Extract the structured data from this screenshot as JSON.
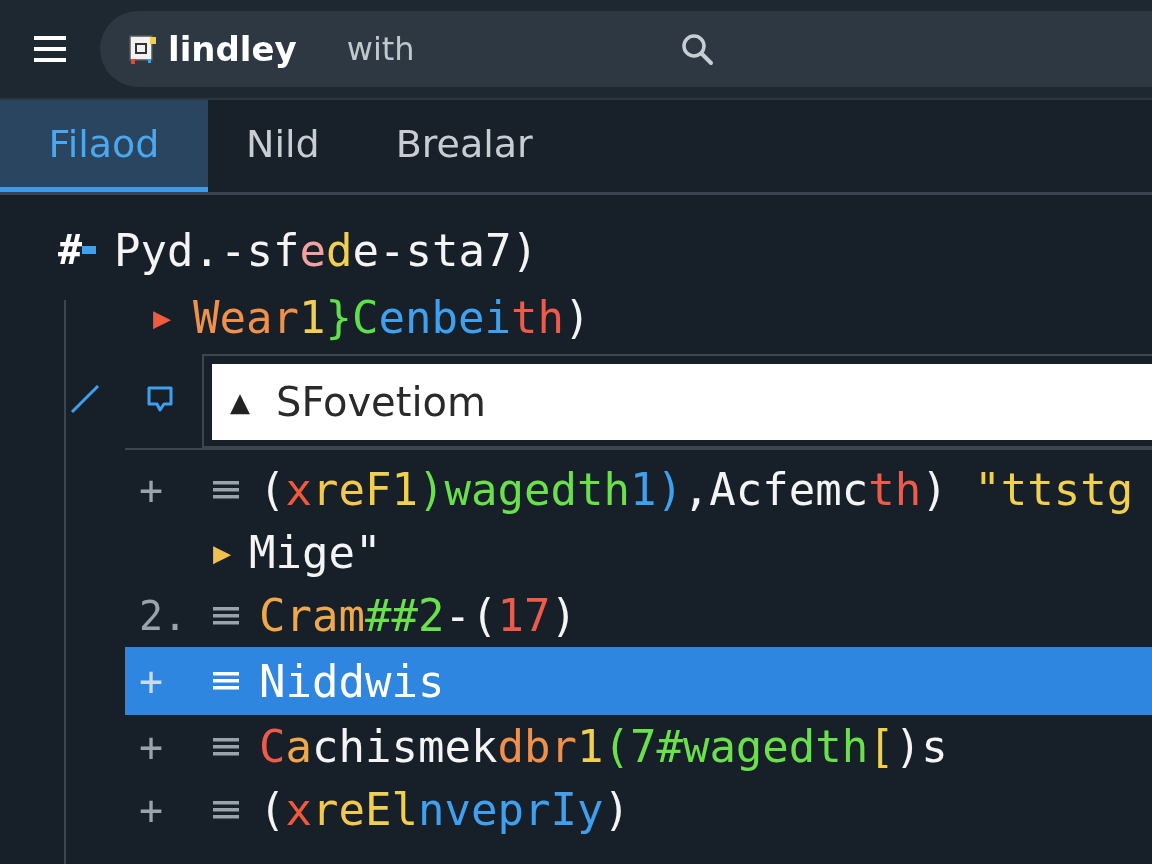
{
  "header": {
    "brand": "lindley",
    "search": {
      "value": "with"
    }
  },
  "tabs": [
    {
      "label": "Filaod",
      "selected": true
    },
    {
      "label": "Nild",
      "selected": false
    },
    {
      "label": "Brealar",
      "selected": false
    }
  ],
  "lines": [
    {
      "kind": "heading",
      "mark": "#",
      "segments": [
        {
          "text": "Pyd.-sf",
          "color": "#f4f4f4"
        },
        {
          "text": "e",
          "color": "#f2a0a0"
        },
        {
          "text": "d",
          "color": "#f2d04f"
        },
        {
          "text": "e-sta7)",
          "color": "#f4f4f4"
        }
      ]
    },
    {
      "kind": "branch",
      "marker": {
        "text": "▶",
        "color": "#f05a40"
      },
      "segments": [
        {
          "text": "Wear",
          "color": "#f0904a"
        },
        {
          "text": "1",
          "color": "#f2d04f"
        },
        {
          "text": "}C",
          "color": "#5ee04a"
        },
        {
          "text": "enbei",
          "color": "#3fa0f0"
        },
        {
          "text": "th",
          "color": "#f05a4a"
        },
        {
          "text": ")",
          "color": "#f4f4f4"
        }
      ]
    },
    {
      "kind": "field",
      "icon": "▲",
      "value": "SFovetiom"
    },
    {
      "kind": "item",
      "gutter": "+",
      "selected": false,
      "segments": [
        {
          "text": "(",
          "color": "#f4f4f4"
        },
        {
          "text": "x",
          "color": "#f05a3a"
        },
        {
          "text": "re",
          "color": "#f2c84f"
        },
        {
          "text": "F1",
          "color": "#f2d04f"
        },
        {
          "text": ")wagedth",
          "color": "#6ae04a"
        },
        {
          "text": "1)",
          "color": "#3fa0f0"
        },
        {
          "text": ",Acfemc",
          "color": "#f4f4f4"
        },
        {
          "text": "th",
          "color": "#f05a4a"
        },
        {
          "text": ") ",
          "color": "#f4f4f4"
        },
        {
          "text": "\"ttstg",
          "color": "#f2d04f"
        }
      ]
    },
    {
      "kind": "item",
      "marker": {
        "text": "▶",
        "color": "#f2c04f"
      },
      "selected": false,
      "segments": [
        {
          "text": "Mige\"",
          "color": "#f4f4f4"
        }
      ]
    },
    {
      "kind": "item",
      "gutter": "2.",
      "selected": false,
      "segments": [
        {
          "text": "Cram",
          "color": "#f0a84a"
        },
        {
          "text": "##2",
          "color": "#6ae04a"
        },
        {
          "text": "-(",
          "color": "#f4f4f4"
        },
        {
          "text": "17",
          "color": "#f05a4a"
        },
        {
          "text": ")",
          "color": "#f4f4f4"
        }
      ]
    },
    {
      "kind": "item",
      "gutter": "+",
      "selected": true,
      "segments": [
        {
          "text": "Niddwis",
          "color": "#ffffff"
        }
      ]
    },
    {
      "kind": "item",
      "gutter": "+",
      "selected": false,
      "segments": [
        {
          "text": "C",
          "color": "#f05a4a"
        },
        {
          "text": "a",
          "color": "#f0a84a"
        },
        {
          "text": "chismek",
          "color": "#f4f4f4"
        },
        {
          "text": "dbr",
          "color": "#f0904a"
        },
        {
          "text": "1",
          "color": "#f2d04f"
        },
        {
          "text": "(7#wagedth",
          "color": "#6ae04a"
        },
        {
          "text": "[",
          "color": "#f2d04f"
        },
        {
          "text": ")s",
          "color": "#f4f4f4"
        }
      ]
    },
    {
      "kind": "item",
      "gutter": "+",
      "selected": false,
      "segments": [
        {
          "text": "(",
          "color": "#f4f4f4"
        },
        {
          "text": "x",
          "color": "#f05a3a"
        },
        {
          "text": "re",
          "color": "#f2c84f"
        },
        {
          "text": "El",
          "color": "#f2d04f"
        },
        {
          "text": "nveprIy",
          "color": "#3fa0f0"
        },
        {
          "text": ")",
          "color": "#f4f4f4"
        }
      ]
    }
  ]
}
